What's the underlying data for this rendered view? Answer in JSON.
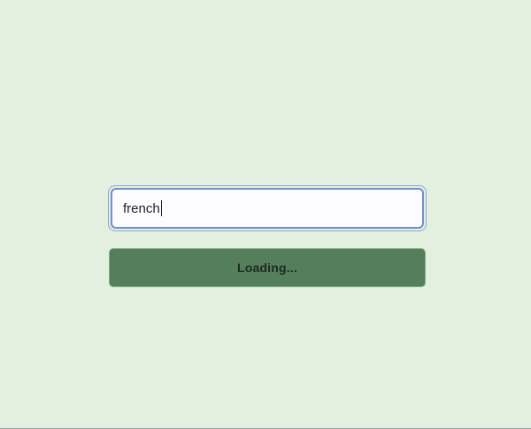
{
  "search": {
    "value": "french"
  },
  "submit": {
    "label": "Loading..."
  },
  "colors": {
    "background": "#e3f0e0",
    "button": "#557f5c",
    "focus_ring": "#6f8fcf"
  }
}
